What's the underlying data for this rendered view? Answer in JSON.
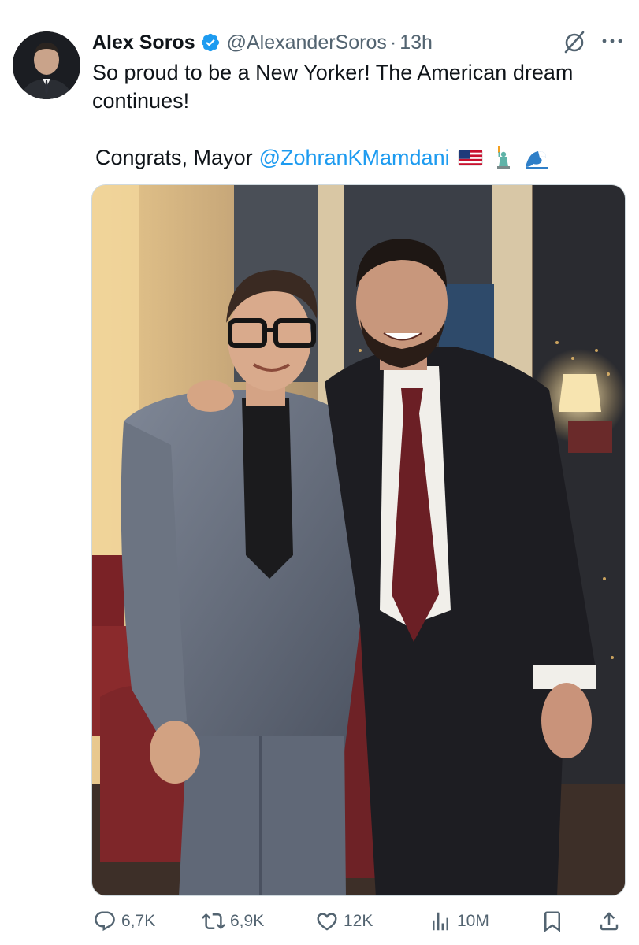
{
  "tweet": {
    "author_name": "Alex Soros",
    "handle": "@AlexanderSoros",
    "separator": "·",
    "time": "13h",
    "text_line1": "So proud to be a New Yorker! The American dream continues!",
    "text_line2_prefix": "Congrats, Mayor",
    "mention": "@ZohranKMamdani",
    "emojis": [
      "us-flag-icon",
      "statue-of-liberty-icon",
      "wave-icon"
    ]
  },
  "actions": {
    "replies": "6,7K",
    "reposts": "6,9K",
    "likes": "12K",
    "views": "10M"
  },
  "colors": {
    "accent": "#1d9bf0",
    "muted": "#536471",
    "text": "#0f1419"
  }
}
